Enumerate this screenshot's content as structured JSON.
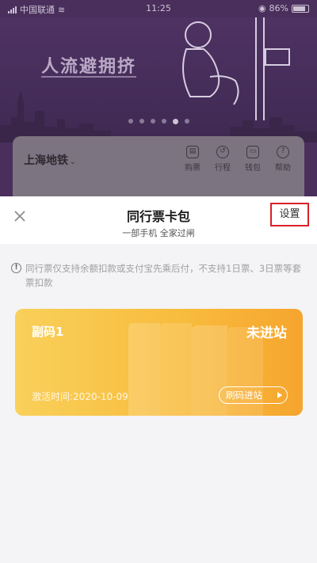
{
  "status_bar": {
    "carrier": "中国联通",
    "time": "11:25",
    "battery": "86%"
  },
  "banner": {
    "title": "人流避拥挤",
    "page_dots_count": 6,
    "active_dot_index": 4
  },
  "metro": {
    "city": "上海地铁",
    "actions": [
      {
        "label": "购票",
        "icon": "ticket-icon"
      },
      {
        "label": "行程",
        "icon": "history-icon"
      },
      {
        "label": "钱包",
        "icon": "wallet-icon"
      },
      {
        "label": "帮助",
        "icon": "help-icon"
      }
    ]
  },
  "sheet": {
    "title": "同行票卡包",
    "subtitle": "一部手机 全家过闸",
    "settings_label": "设置",
    "notice": "同行票仅支持余额扣款或支付宝先乘后付，不支持1日票、3日票等套票扣款"
  },
  "ticket": {
    "code_label": "副码1",
    "status": "未进站",
    "activation": "激活时间:2020-10-09",
    "scan_label": "刷码进站"
  },
  "colors": {
    "ticket_start": "#f9d05a",
    "ticket_end": "#f6a52e",
    "highlight_box": "#d9202a"
  }
}
